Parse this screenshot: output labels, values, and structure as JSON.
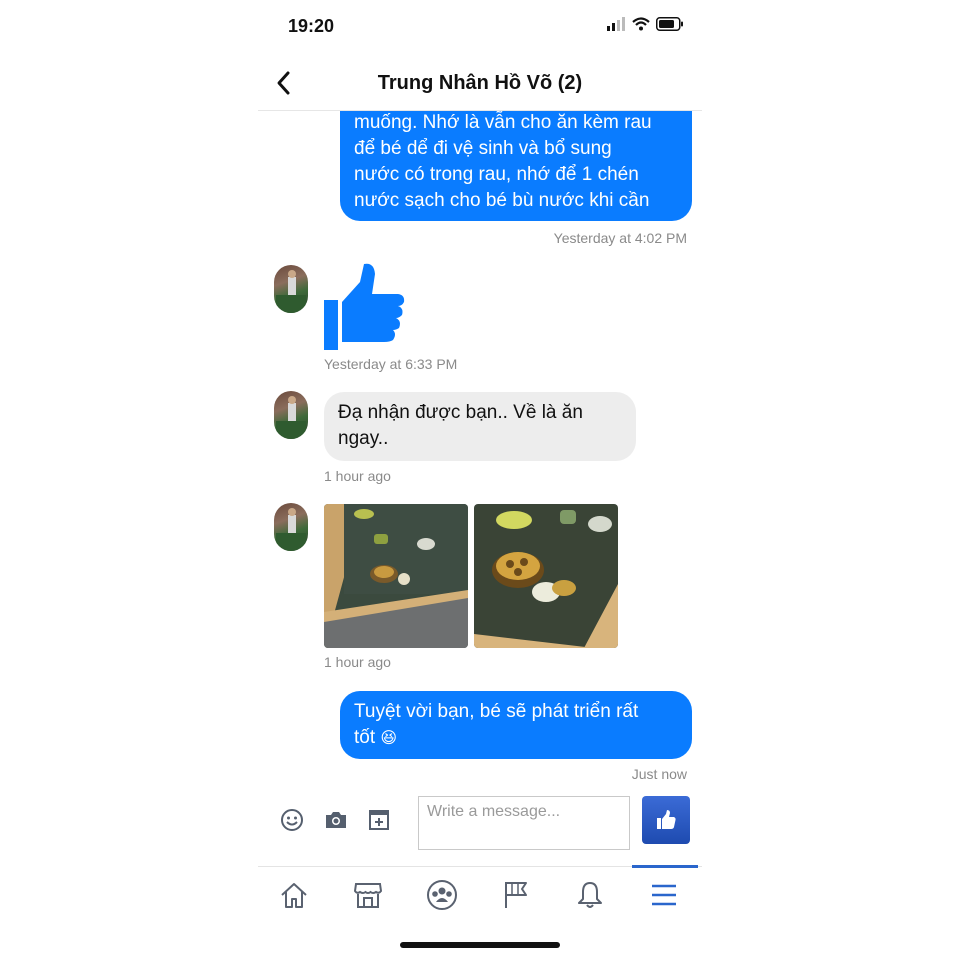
{
  "status_bar": {
    "time": "19:20"
  },
  "header": {
    "title": "Trung Nhân Hồ Võ (2)"
  },
  "messages": {
    "m1": {
      "lines": [
        "muống. Nhớ là vẫn cho ăn kèm rau",
        "để bé dể đi vệ sinh và bổ sung",
        "nước có trong rau, nhớ để 1 chén",
        "nước sạch cho bé bù nước khi cần"
      ],
      "timestamp": "Yesterday at 4:02 PM"
    },
    "m2": {
      "content": "thumbs-up",
      "timestamp": "Yesterday at 6:33 PM"
    },
    "m3": {
      "line1": "Đạ nhận được bạn.. Về là ăn",
      "line2": "ngay..",
      "timestamp": "1 hour ago"
    },
    "m4": {
      "photos": [
        "turtle-photo-1",
        "turtle-photo-2"
      ],
      "timestamp": "1 hour ago"
    },
    "m5": {
      "line1": "Tuyệt vời bạn, bé sẽ phát triển rất",
      "line2": "tốt",
      "emoji": "😆",
      "timestamp": "Just now"
    }
  },
  "composer": {
    "placeholder": "Write a message..."
  },
  "icons": {
    "tools": [
      "emoji-icon",
      "camera-icon",
      "gallery-add-icon"
    ],
    "send": "thumbs-up-icon",
    "nav": [
      "home-icon",
      "marketplace-icon",
      "groups-icon",
      "pages-flag-icon",
      "notifications-bell-icon",
      "menu-icon"
    ]
  },
  "colors": {
    "accent": "#0a7cff",
    "nav_active": "#2a66cc",
    "incoming_bubble": "#ededed"
  }
}
